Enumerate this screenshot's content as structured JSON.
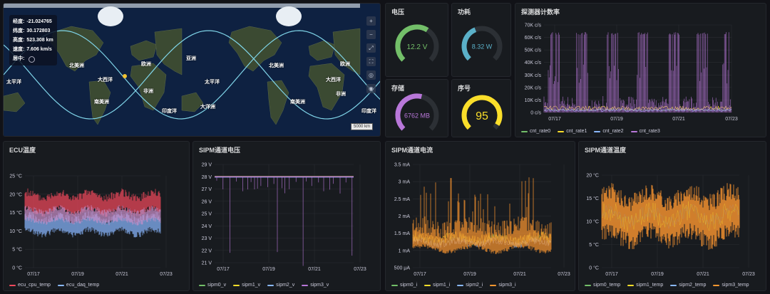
{
  "map": {
    "info": [
      {
        "label": "经度:",
        "value": "-21.024765"
      },
      {
        "label": "纬度:",
        "value": "30.172803"
      },
      {
        "label": "高度:",
        "value": "523.308 km"
      },
      {
        "label": "速度:",
        "value": "7.606 km/s"
      },
      {
        "label": "居中:",
        "value": ""
      }
    ],
    "labels": [
      {
        "text": "北美洲",
        "cls": "na1"
      },
      {
        "text": "大西洋",
        "cls": "at1"
      },
      {
        "text": "欧洲",
        "cls": "eu1"
      },
      {
        "text": "亚洲",
        "cls": "as1"
      },
      {
        "text": "非洲",
        "cls": "af1"
      },
      {
        "text": "南美洲",
        "cls": "sa1"
      },
      {
        "text": "印度洋",
        "cls": "io1"
      },
      {
        "text": "太平洋",
        "cls": "pa1"
      },
      {
        "text": "太平洋",
        "cls": "pa2"
      },
      {
        "text": "大洋洲",
        "cls": "oc1"
      },
      {
        "text": "北美洲",
        "cls": "na2"
      },
      {
        "text": "大西洋",
        "cls": "at2"
      },
      {
        "text": "欧洲",
        "cls": "eu2"
      },
      {
        "text": "非洲",
        "cls": "af2"
      },
      {
        "text": "南美洲",
        "cls": "sa2"
      },
      {
        "text": "印度洋",
        "cls": "io2"
      }
    ],
    "scale": "5000 km",
    "controls": [
      "+",
      "−",
      "⤢",
      "⛶",
      "◎",
      "◉"
    ],
    "colors": {
      "track": "#7fd4e8",
      "satellite": "#f2c230"
    }
  },
  "voltage": {
    "title": "电压",
    "value": "12.2 V",
    "fraction": 0.62,
    "color": "#73bf69"
  },
  "power": {
    "title": "功耗",
    "value": "8.32 W",
    "fraction": 0.42,
    "color": "#5ab0c8"
  },
  "storage": {
    "title": "存储",
    "value": "6762 MB",
    "fraction": 0.55,
    "color": "#b877d9"
  },
  "sequence": {
    "title": "序号",
    "value": "95",
    "fraction": 0.95,
    "color": "#fade2a"
  },
  "chart_data": [
    {
      "id": "det",
      "title": "探测器计数率",
      "type": "line",
      "yticks": [
        "0 c/s",
        "10K c/s",
        "20K c/s",
        "30K c/s",
        "40K c/s",
        "50K c/s",
        "60K c/s",
        "70K c/s"
      ],
      "xticks": [
        "07/17",
        "07/19",
        "07/21",
        "07/23"
      ],
      "series": [
        {
          "name": "cnt_rate0",
          "color": "#73bf69"
        },
        {
          "name": "cnt_rate1",
          "color": "#fade2a"
        },
        {
          "name": "cnt_rate2",
          "color": "#8ab8ff"
        },
        {
          "name": "cnt_rate3",
          "color": "#b877d9"
        }
      ]
    },
    {
      "id": "ecu",
      "title": "ECU温度",
      "type": "line",
      "yticks": [
        "0 °C",
        "5 °C",
        "10 °C",
        "15 °C",
        "20 °C",
        "25 °C"
      ],
      "xticks": [
        "07/17",
        "07/19",
        "07/21",
        "07/23"
      ],
      "series": [
        {
          "name": "ecu_cpu_temp",
          "color": "#f2495c"
        },
        {
          "name": "ecu_daq_temp",
          "color": "#8ab8ff"
        }
      ]
    },
    {
      "id": "sv",
      "title": "SIPM通道电压",
      "type": "line",
      "yticks": [
        "21 V",
        "22 V",
        "23 V",
        "24 V",
        "25 V",
        "26 V",
        "27 V",
        "28 V",
        "29 V"
      ],
      "xticks": [
        "07/17",
        "07/19",
        "07/21",
        "07/23"
      ],
      "series": [
        {
          "name": "sipm0_v",
          "color": "#73bf69"
        },
        {
          "name": "sipm1_v",
          "color": "#fade2a"
        },
        {
          "name": "sipm2_v",
          "color": "#8ab8ff"
        },
        {
          "name": "sipm3_v",
          "color": "#b877d9"
        }
      ]
    },
    {
      "id": "si",
      "title": "SIPM通道电流",
      "type": "line",
      "yticks": [
        "500 μA",
        "1 mA",
        "1.5 mA",
        "2 mA",
        "2.5 mA",
        "3 mA",
        "3.5 mA"
      ],
      "xticks": [
        "07/17",
        "07/19",
        "07/21",
        "07/23"
      ],
      "series": [
        {
          "name": "sipm0_i",
          "color": "#73bf69"
        },
        {
          "name": "sipm1_i",
          "color": "#fade2a"
        },
        {
          "name": "sipm2_i",
          "color": "#8ab8ff"
        },
        {
          "name": "sipm3_i",
          "color": "#ff9830"
        }
      ]
    },
    {
      "id": "st",
      "title": "SIPM通道温度",
      "type": "line",
      "yticks": [
        "0 °C",
        "5 °C",
        "10 °C",
        "15 °C",
        "20 °C"
      ],
      "xticks": [
        "07/17",
        "07/19",
        "07/21",
        "07/23"
      ],
      "series": [
        {
          "name": "sipm0_temp",
          "color": "#73bf69"
        },
        {
          "name": "sipm1_temp",
          "color": "#fade2a"
        },
        {
          "name": "sipm2_temp",
          "color": "#8ab8ff"
        },
        {
          "name": "sipm3_temp",
          "color": "#ff9830"
        }
      ]
    }
  ]
}
